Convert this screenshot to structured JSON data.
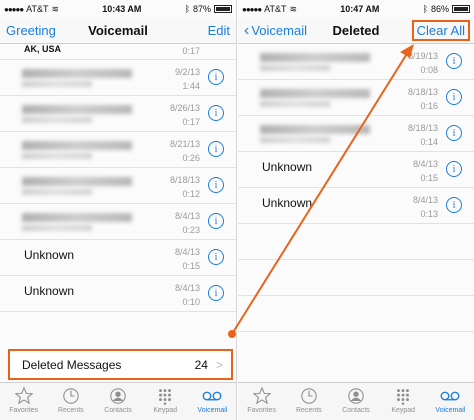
{
  "left": {
    "status": {
      "carrier": "AT&T",
      "time": "10:43 AM",
      "battery": "87%"
    },
    "nav": {
      "left": "Greeting",
      "title": "Voicemail",
      "right": "Edit"
    },
    "rows": [
      {
        "name": "AK, USA",
        "date": "",
        "dur": "0:17",
        "blurred": false,
        "partial": true
      },
      {
        "name": "",
        "date": "9/2/13",
        "dur": "1:44",
        "blurred": true
      },
      {
        "name": "",
        "date": "8/26/13",
        "dur": "0:17",
        "blurred": true
      },
      {
        "name": "",
        "date": "8/21/13",
        "dur": "0:26",
        "blurred": true
      },
      {
        "name": "",
        "date": "8/18/13",
        "dur": "0:12",
        "blurred": true
      },
      {
        "name": "",
        "date": "8/4/13",
        "dur": "0:23",
        "blurred": true
      },
      {
        "name": "Unknown",
        "date": "8/4/13",
        "dur": "0:15",
        "blurred": false
      },
      {
        "name": "Unknown",
        "date": "8/4/13",
        "dur": "0:10",
        "blurred": false
      }
    ],
    "deleted": {
      "label": "Deleted Messages",
      "count": "24"
    }
  },
  "right": {
    "status": {
      "carrier": "AT&T",
      "time": "10:47 AM",
      "battery": "86%"
    },
    "nav": {
      "left": "Voicemail",
      "title": "Deleted",
      "right": "Clear All"
    },
    "rows": [
      {
        "name": "",
        "date": "8/19/13",
        "dur": "0:08",
        "blurred": true
      },
      {
        "name": "",
        "date": "8/18/13",
        "dur": "0:16",
        "blurred": true
      },
      {
        "name": "",
        "date": "8/18/13",
        "dur": "0:14",
        "blurred": true
      },
      {
        "name": "Unknown",
        "date": "8/4/13",
        "dur": "0:15",
        "blurred": false
      },
      {
        "name": "Unknown",
        "date": "8/4/13",
        "dur": "0:13",
        "blurred": false
      }
    ]
  },
  "tabs": [
    {
      "label": "Favorites",
      "icon": "star-icon"
    },
    {
      "label": "Recents",
      "icon": "clock-icon"
    },
    {
      "label": "Contacts",
      "icon": "contact-icon"
    },
    {
      "label": "Keypad",
      "icon": "keypad-icon"
    },
    {
      "label": "Voicemail",
      "icon": "voicemail-icon",
      "active": true
    }
  ],
  "colors": {
    "accent": "#1a7de0",
    "highlight": "#e8641c"
  }
}
